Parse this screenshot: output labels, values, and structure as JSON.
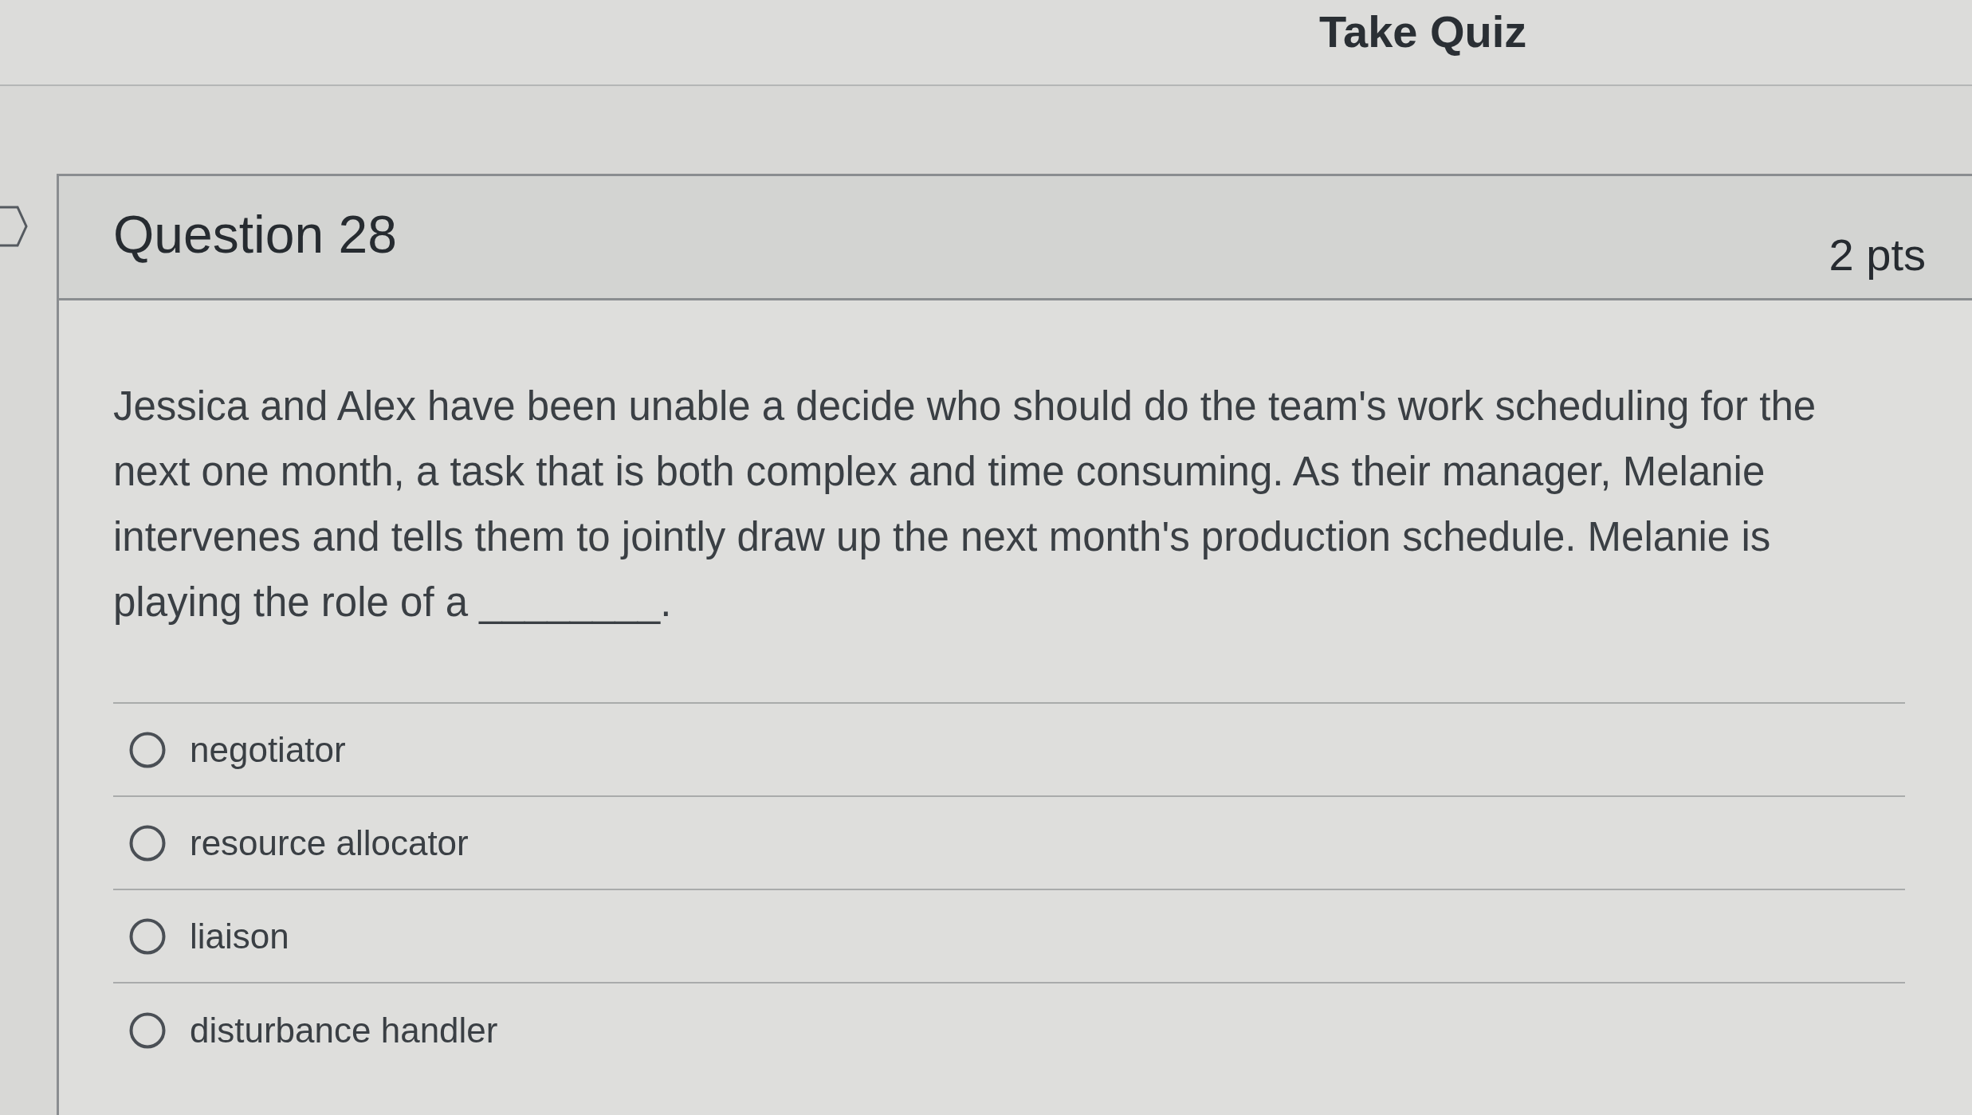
{
  "page": {
    "title": "Take Quiz"
  },
  "question": {
    "title": "Question 28",
    "points": "2 pts",
    "text": "Jessica and Alex have been unable a decide who should do the team's work scheduling for the next one month, a task that is both complex and time consuming. As their manager, Melanie intervenes and tells them to jointly draw up the next month's production schedule. Melanie is playing the role of a ________.",
    "answers": [
      {
        "label": "negotiator",
        "selected": false
      },
      {
        "label": "resource allocator",
        "selected": false
      },
      {
        "label": "liaison",
        "selected": false
      },
      {
        "label": "disturbance handler",
        "selected": false
      }
    ]
  }
}
